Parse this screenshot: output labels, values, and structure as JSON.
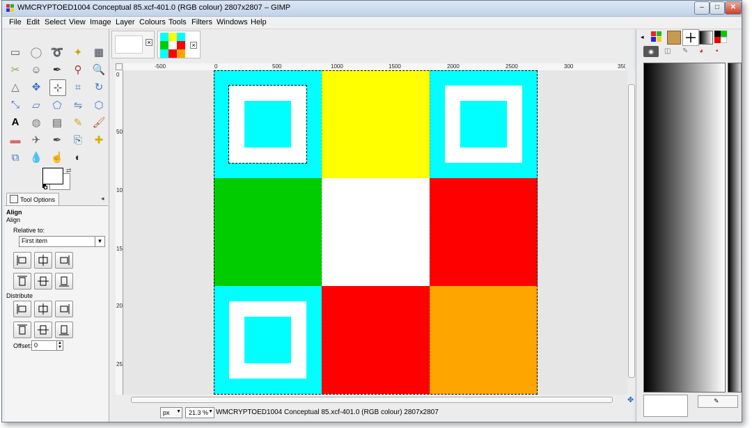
{
  "window": {
    "title": "WMCRYPTOED1004 Conceptual 85.xcf-401.0 (RGB colour) 2807x2807 – GIMP",
    "controls": {
      "minimize": "–",
      "maximize": "□",
      "close": "✕"
    }
  },
  "menubar": [
    "File",
    "Edit",
    "Select",
    "View",
    "Image",
    "Layer",
    "Colours",
    "Tools",
    "Filters",
    "Windows",
    "Help"
  ],
  "toolbox": {
    "tools": [
      "rect-select",
      "ellipse-select",
      "free-select",
      "fuzzy-select",
      "select-by-color",
      "scissors",
      "foreground-select",
      "paths",
      "color-picker",
      "zoom",
      "measure",
      "move",
      "align",
      "crop",
      "rotate",
      "scale",
      "shear",
      "perspective",
      "flip",
      "cage",
      "text",
      "bucket-fill",
      "blend",
      "pencil",
      "paintbrush",
      "eraser",
      "airbrush",
      "ink",
      "clone",
      "heal",
      "perspective-clone",
      "blur",
      "smudge",
      "dodge-burn"
    ],
    "active_tool": "align"
  },
  "tool_options": {
    "tab_label": "Tool Options",
    "header": "Align",
    "subheader": "Align",
    "relative_to_label": "Relative to:",
    "relative_to_value": "First item",
    "distribute_label": "Distribute",
    "offset_label": "Offset:",
    "offset_value": "0"
  },
  "canvas": {
    "ruler_labels": [
      "-500",
      "0",
      "500",
      "1000",
      "1500",
      "2000",
      "2500",
      "300",
      "350"
    ],
    "vruler_labels": [
      "0",
      "500",
      "1000",
      "1500",
      "2000",
      "2500"
    ],
    "grid_colors": [
      [
        "#00ffff",
        "#ffff00",
        "#00ffff"
      ],
      [
        "#00cc00",
        "#ffffff",
        "#ff0000"
      ],
      [
        "#00ffff",
        "#ff0000",
        "#ffa500"
      ]
    ],
    "finder_frame": "#ffffff",
    "finder_center": "#00ffff"
  },
  "statusbar": {
    "unit": "px",
    "zoom": "21.3 %",
    "info": "WMCRYPTOED1004 Conceptual 85.xcf-401.0 (RGB colour) 2807x2807"
  }
}
